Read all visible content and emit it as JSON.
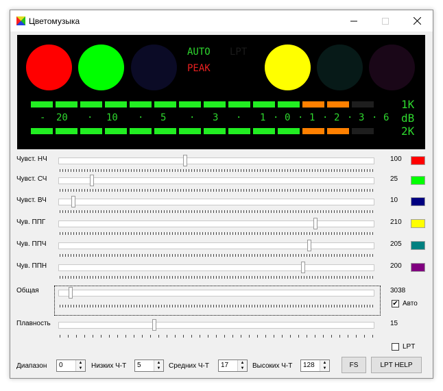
{
  "window": {
    "title": "Цветомузыка"
  },
  "panel": {
    "auto_text": "AUTO",
    "lpt_text": "LPT",
    "peak_text": "PEAK",
    "top_label": "1K",
    "mid_label": "dB",
    "bottom_label": "2K",
    "scale": [
      "-",
      "20",
      "·",
      "10",
      "·",
      "5",
      "·",
      "3",
      "·",
      "1",
      "·",
      "0",
      "·",
      "1",
      "·",
      "2",
      "·",
      "3",
      "·",
      "6"
    ],
    "colors": {
      "lamp_red": "#ff0000",
      "lamp_green": "#00ff00",
      "lamp_navy_dim": "#0b0b26",
      "lamp_yellow": "#ffff00",
      "lamp_teal_dim": "#071a18",
      "lamp_purple_dim": "#1a0718",
      "bar_green": "#22ee22",
      "bar_orange": "#ff8000",
      "bar_dim": "#1e1e1e",
      "text_green": "#2ed82e",
      "text_red": "#e82020",
      "text_dim": "#1b1b1b"
    }
  },
  "sliders": [
    {
      "label": "Чувст. НЧ",
      "value": "100",
      "level": 0.4,
      "color": "#ff0000"
    },
    {
      "label": "Чувст. СЧ",
      "value": "25",
      "level": 0.1,
      "color": "#00ff00"
    },
    {
      "label": "Чувст. ВЧ",
      "value": "10",
      "level": 0.04,
      "color": "#000080"
    },
    {
      "label": "Чув. ППГ",
      "value": "210",
      "level": 0.82,
      "color": "#ffff00"
    },
    {
      "label": "Чув. ППЧ",
      "value": "205",
      "level": 0.8,
      "color": "#008080"
    },
    {
      "label": "Чув. ППН",
      "value": "200",
      "level": 0.78,
      "color": "#800080"
    }
  ],
  "total": {
    "label": "Общая",
    "value": "3038",
    "level": 0.03,
    "auto_label": "Авто",
    "auto_checked": true
  },
  "smooth": {
    "label": "Плавность",
    "value": "15",
    "level": 0.3
  },
  "lpt": {
    "label": "LPT",
    "checked": false
  },
  "bottom": {
    "range_label": "Диапазон",
    "range_value": "0",
    "low_label": "Низких Ч-Т",
    "low_value": "5",
    "mid_label": "Средних Ч-Т",
    "mid_value": "17",
    "high_label": "Высоких Ч-Т",
    "high_value": "128",
    "fs_button": "FS",
    "lpt_help_button": "LPT HELP"
  }
}
